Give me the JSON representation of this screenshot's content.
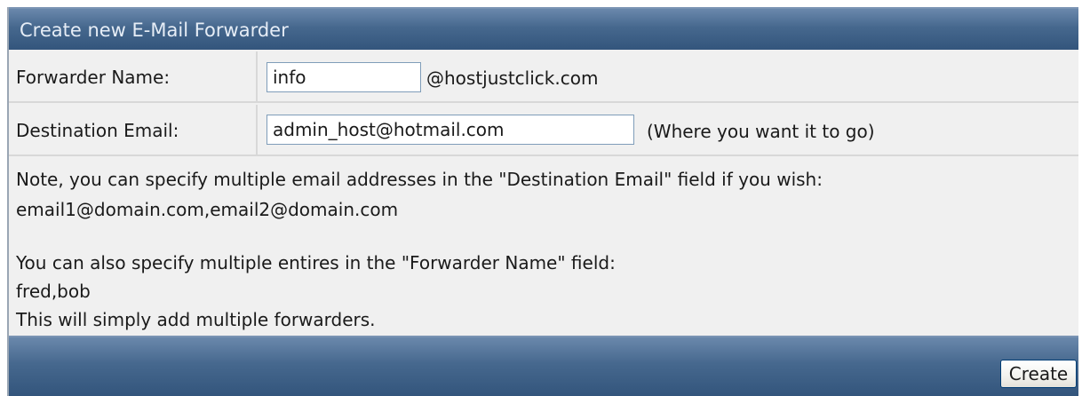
{
  "form": {
    "title": "Create new E-Mail Forwarder",
    "forwarder": {
      "label": "Forwarder Name:",
      "value": "info",
      "domain_suffix": "@hostjustclick.com"
    },
    "destination": {
      "label": "Destination Email:",
      "value": "admin_host@hotmail.com",
      "hint": "(Where you want it to go)"
    },
    "notes": [
      "Note, you can specify multiple email addresses in the \"Destination Email\" field if you wish:",
      "email1@domain.com,email2@domain.com",
      "You can also specify multiple entires in the \"Forwarder Name\" field:",
      "fred,bob",
      "This will simply add multiple forwarders."
    ],
    "submit_label": "Create"
  },
  "colors": {
    "header_bar": "#46688e",
    "panel_background": "#f0f0f0",
    "input_border": "#7f9db9"
  }
}
